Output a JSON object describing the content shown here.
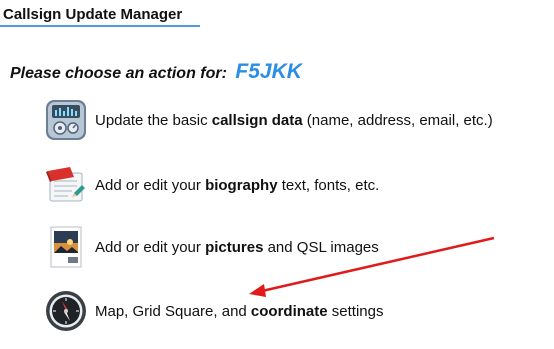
{
  "header": {
    "title": "Callsign Update Manager"
  },
  "prompt": {
    "text": "Please choose an action for:",
    "callsign": "F5JKK",
    "callsign_color": "#2a8ee6"
  },
  "actions": [
    {
      "icon": "settings-panel-icon",
      "prefix": "Update the basic ",
      "bold": "callsign data",
      "suffix": " (name, address, email, etc.)"
    },
    {
      "icon": "edit-document-icon",
      "prefix": "Add or edit your ",
      "bold": "biography",
      "suffix": " text, fonts, etc."
    },
    {
      "icon": "picture-icon",
      "prefix": "Add or edit your ",
      "bold": "pictures",
      "suffix": " and QSL images"
    },
    {
      "icon": "compass-icon",
      "prefix": "Map, Grid Square, and ",
      "bold": "coordinate",
      "suffix": " settings"
    }
  ],
  "annotation": {
    "arrow_color": "#e01b1b"
  }
}
